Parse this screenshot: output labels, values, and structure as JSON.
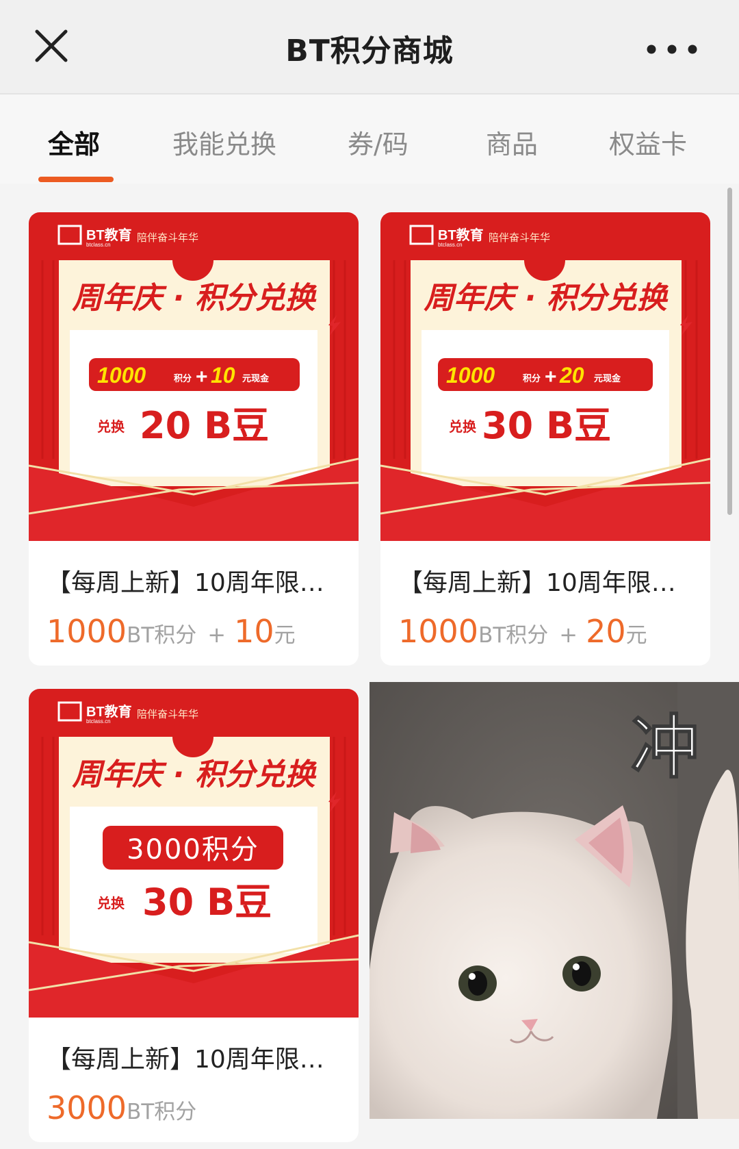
{
  "nav": {
    "title": "BT积分商城",
    "close_icon": "close-icon",
    "more_icon": "more-dots-icon"
  },
  "tabs": [
    {
      "label": "全部",
      "active": true
    },
    {
      "label": "我能兑换",
      "active": false
    },
    {
      "label": "券/码",
      "active": false
    },
    {
      "label": "商品",
      "active": false
    },
    {
      "label": "权益卡",
      "active": false
    }
  ],
  "products": [
    {
      "banner": {
        "logo": "BT教育",
        "logo_domain": "btclass.cn",
        "slogan": "陪伴奋斗年华",
        "headline": "周年庆 · 积分兑换",
        "offer_points": "1000",
        "offer_points_unit": "积分",
        "offer_plus": "+",
        "offer_cash": "10",
        "offer_cash_unit": "元现金",
        "exchange_prefix": "兑换",
        "exchange_amount": "20 B豆"
      },
      "name": "【每周上新】10周年限…",
      "price_points": "1000",
      "price_points_unit": "BT积分",
      "price_plus": "+",
      "price_cash": "10",
      "price_cash_unit": "元"
    },
    {
      "banner": {
        "logo": "BT教育",
        "logo_domain": "btclass.cn",
        "slogan": "陪伴奋斗年华",
        "headline": "周年庆 · 积分兑换",
        "offer_points": "1000",
        "offer_points_unit": "积分",
        "offer_plus": "+",
        "offer_cash": "20",
        "offer_cash_unit": "元现金",
        "exchange_prefix": "兑换",
        "exchange_amount": "30 B豆"
      },
      "name": "【每周上新】10周年限…",
      "price_points": "1000",
      "price_points_unit": "BT积分",
      "price_plus": "+",
      "price_cash": "20",
      "price_cash_unit": "元"
    },
    {
      "banner": {
        "logo": "BT教育",
        "logo_domain": "btclass.cn",
        "slogan": "陪伴奋斗年华",
        "headline": "周年庆 · 积分兑换",
        "offer_text": "3000积分",
        "exchange_prefix": "兑换",
        "exchange_amount": "30 B豆"
      },
      "name": "【每周上新】10周年限…",
      "price_points": "3000",
      "price_points_unit": "BT积分"
    }
  ],
  "sticker": {
    "caption": "冲"
  },
  "colors": {
    "accent": "#ec5b22",
    "price": "#ee6a2a",
    "banner_red": "#d81e1e",
    "banner_cream": "#fdf3da"
  }
}
